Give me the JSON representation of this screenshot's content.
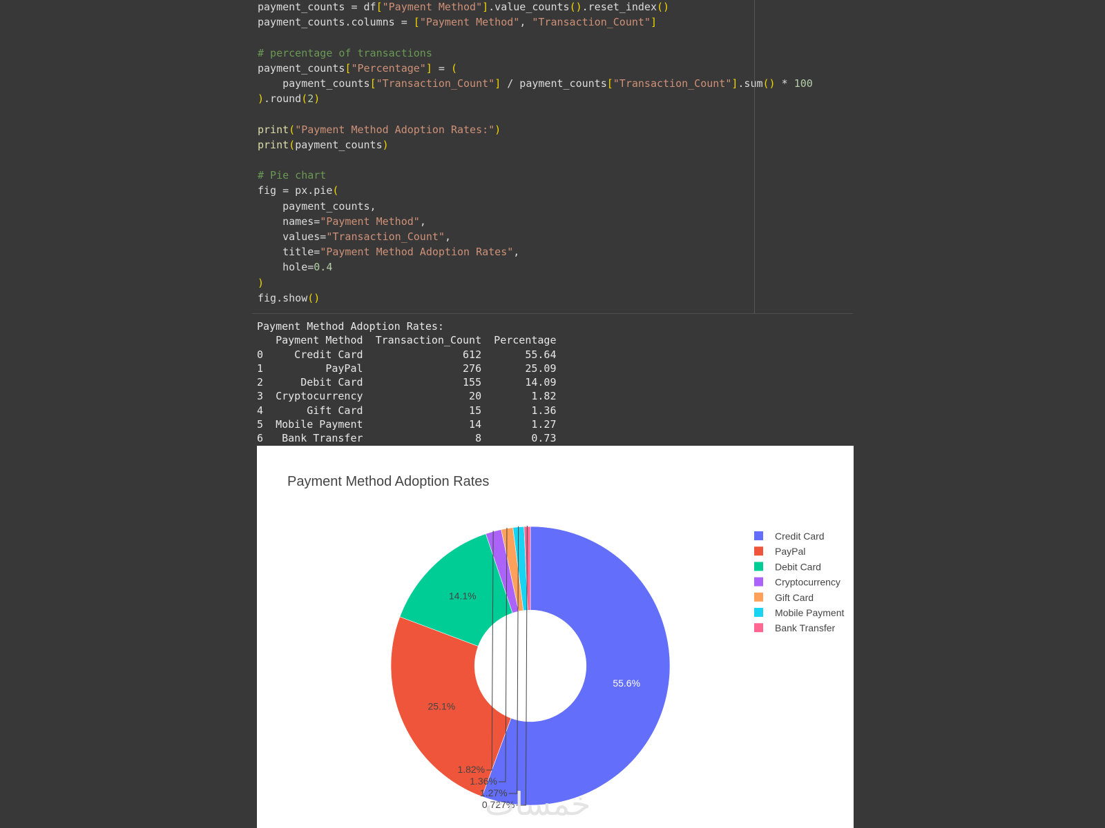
{
  "code": {
    "lines": [
      [
        [
          "t-plain",
          "payment_counts = df"
        ],
        [
          "t-br",
          "["
        ],
        [
          "t-str",
          "\"Payment Method\""
        ],
        [
          "t-br",
          "]"
        ],
        [
          "t-plain",
          ".value_counts"
        ],
        [
          "t-br",
          "()"
        ],
        [
          "t-plain",
          ".reset_index"
        ],
        [
          "t-br",
          "()"
        ]
      ],
      [
        [
          "t-plain",
          "payment_counts.columns = "
        ],
        [
          "t-br",
          "["
        ],
        [
          "t-str",
          "\"Payment Method\""
        ],
        [
          "t-plain",
          ", "
        ],
        [
          "t-str",
          "\"Transaction_Count\""
        ],
        [
          "t-br",
          "]"
        ]
      ],
      [],
      [
        [
          "t-cmt",
          "# percentage of transactions"
        ]
      ],
      [
        [
          "t-plain",
          "payment_counts"
        ],
        [
          "t-br",
          "["
        ],
        [
          "t-str",
          "\"Percentage\""
        ],
        [
          "t-br",
          "]"
        ],
        [
          "t-plain",
          " = "
        ],
        [
          "t-br",
          "("
        ]
      ],
      [
        [
          "t-plain",
          "    payment_counts"
        ],
        [
          "t-br",
          "["
        ],
        [
          "t-str",
          "\"Transaction_Count\""
        ],
        [
          "t-br",
          "]"
        ],
        [
          "t-plain",
          " / payment_counts"
        ],
        [
          "t-br",
          "["
        ],
        [
          "t-str",
          "\"Transaction_Count\""
        ],
        [
          "t-br",
          "]"
        ],
        [
          "t-plain",
          ".sum"
        ],
        [
          "t-br",
          "()"
        ],
        [
          "t-plain",
          " * "
        ],
        [
          "t-num",
          "100"
        ]
      ],
      [
        [
          "t-br",
          ")"
        ],
        [
          "t-plain",
          ".round"
        ],
        [
          "t-br",
          "("
        ],
        [
          "t-num",
          "2"
        ],
        [
          "t-br",
          ")"
        ]
      ],
      [],
      [
        [
          "t-fn",
          "print"
        ],
        [
          "t-br",
          "("
        ],
        [
          "t-str",
          "\"Payment Method Adoption Rates:\""
        ],
        [
          "t-br",
          ")"
        ]
      ],
      [
        [
          "t-fn",
          "print"
        ],
        [
          "t-br",
          "("
        ],
        [
          "t-plain",
          "payment_counts"
        ],
        [
          "t-br",
          ")"
        ]
      ],
      [],
      [
        [
          "t-cmt",
          "# Pie chart"
        ]
      ],
      [
        [
          "t-plain",
          "fig = px.pie"
        ],
        [
          "t-br",
          "("
        ]
      ],
      [
        [
          "t-plain",
          "    payment_counts,"
        ]
      ],
      [
        [
          "t-plain",
          "    names="
        ],
        [
          "t-str",
          "\"Payment Method\""
        ],
        [
          "t-plain",
          ","
        ]
      ],
      [
        [
          "t-plain",
          "    values="
        ],
        [
          "t-str",
          "\"Transaction_Count\""
        ],
        [
          "t-plain",
          ","
        ]
      ],
      [
        [
          "t-plain",
          "    title="
        ],
        [
          "t-str",
          "\"Payment Method Adoption Rates\""
        ],
        [
          "t-plain",
          ","
        ]
      ],
      [
        [
          "t-plain",
          "    hole="
        ],
        [
          "t-num",
          "0.4"
        ]
      ],
      [
        [
          "t-br",
          ")"
        ]
      ],
      [
        [
          "t-plain",
          "fig.show"
        ],
        [
          "t-br",
          "()"
        ]
      ]
    ]
  },
  "output": {
    "lines": [
      "Payment Method Adoption Rates:",
      "   Payment Method  Transaction_Count  Percentage",
      "0     Credit Card                612       55.64",
      "1          PayPal                276       25.09",
      "2      Debit Card                155       14.09",
      "3  Cryptocurrency                 20        1.82",
      "4       Gift Card                 15        1.36",
      "5  Mobile Payment                 14        1.27",
      "6   Bank Transfer                  8        0.73"
    ]
  },
  "chart_data": {
    "type": "pie",
    "title": "Payment Method Adoption Rates",
    "hole": 0.4,
    "labels": [
      "Credit Card",
      "PayPal",
      "Debit Card",
      "Cryptocurrency",
      "Gift Card",
      "Mobile Payment",
      "Bank Transfer"
    ],
    "values": [
      612,
      276,
      155,
      20,
      15,
      14,
      8
    ],
    "percent_labels": [
      "55.6%",
      "25.1%",
      "14.1%",
      "1.82%",
      "1.36%",
      "1.27%",
      "0.727%"
    ],
    "colors": [
      "#636efa",
      "#ef553b",
      "#00cc96",
      "#ab63fa",
      "#ffa15a",
      "#19d3f3",
      "#ff6692"
    ],
    "legend_position": "right"
  },
  "watermark": {
    "text": "خمسات"
  }
}
